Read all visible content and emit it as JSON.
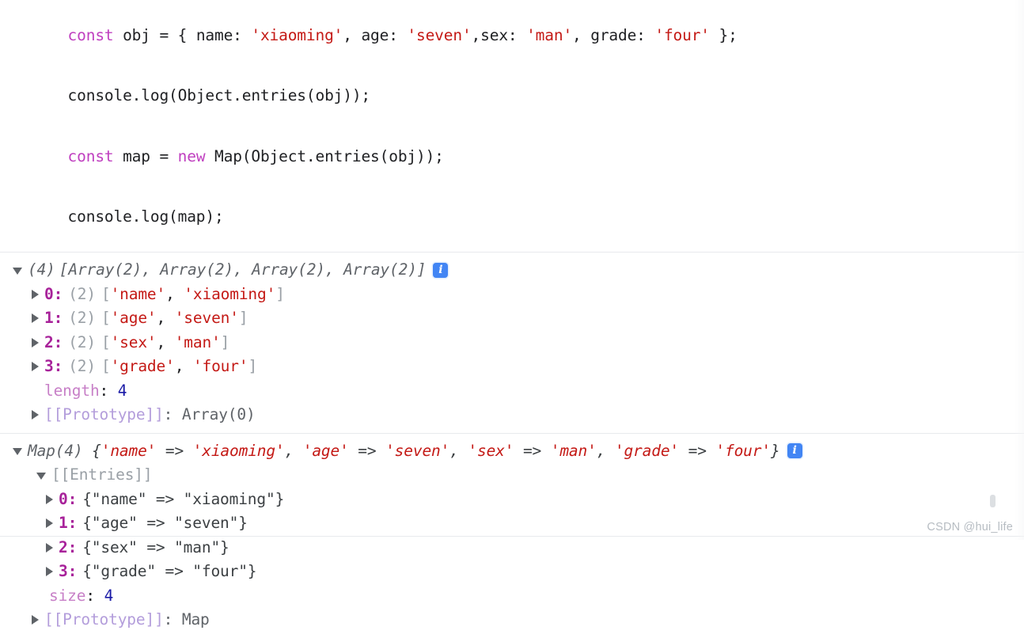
{
  "app": {
    "name": "browser-devtools-console",
    "watermark": "CSDN @hui_life"
  },
  "code_editor": {
    "lines": [
      {
        "id": "line-1",
        "tokens": [
          {
            "text": "const ",
            "style": "kw"
          },
          {
            "text": "obj = { name: ",
            "style": "plain"
          },
          {
            "text": "'xiaoming'",
            "style": "str"
          },
          {
            "text": ", age: ",
            "style": "plain"
          },
          {
            "text": "'seven'",
            "style": "str"
          },
          {
            "text": ",sex: ",
            "style": "plain"
          },
          {
            "text": "'man'",
            "style": "str"
          },
          {
            "text": ", grade: ",
            "style": "plain"
          },
          {
            "text": "'four'",
            "style": "str"
          },
          {
            "text": " };",
            "style": "plain"
          }
        ],
        "plain": "const obj = { name: 'xiaoming', age: 'seven',sex: 'man', grade: 'four' };"
      },
      {
        "id": "line-2",
        "tokens": [
          {
            "text": "console.log(Object.entries(obj));",
            "style": "plain"
          }
        ],
        "plain": "console.log(Object.entries(obj));"
      },
      {
        "id": "line-3",
        "tokens": [
          {
            "text": "const ",
            "style": "kw"
          },
          {
            "text": "map = ",
            "style": "plain"
          },
          {
            "text": "new ",
            "style": "kw"
          },
          {
            "text": "Map(Object.entries(obj));",
            "style": "plain"
          }
        ],
        "plain": "const map = new Map(Object.entries(obj));"
      },
      {
        "id": "line-4",
        "tokens": [
          {
            "text": "console.log(map);",
            "style": "plain"
          }
        ],
        "plain": "console.log(map);"
      }
    ]
  },
  "output_array": {
    "expanded": true,
    "header": {
      "count_label": "(4)",
      "preview": "[Array(2), Array(2), Array(2), Array(2)]",
      "info_badge": "i"
    },
    "rows": [
      {
        "index": "0:",
        "count": "(2)",
        "value": "['name', 'xiaoming']",
        "key_str": "'name'",
        "val_str": "'xiaoming'",
        "expanded": false
      },
      {
        "index": "1:",
        "count": "(2)",
        "value": "['age', 'seven']",
        "key_str": "'age'",
        "val_str": "'seven'",
        "expanded": false
      },
      {
        "index": "2:",
        "count": "(2)",
        "value": "['sex', 'man']",
        "key_str": "'sex'",
        "val_str": "'man'",
        "expanded": false
      },
      {
        "index": "3:",
        "count": "(2)",
        "value": "['grade', 'four']",
        "key_str": "'grade'",
        "val_str": "'four'",
        "expanded": false
      }
    ],
    "length_prop": {
      "name": "length",
      "separator": ": ",
      "value": "4"
    },
    "prototype": {
      "name": "[[Prototype]]",
      "separator": ": ",
      "value": "Array(0)"
    }
  },
  "output_map": {
    "expanded": true,
    "header": {
      "label": "Map(4) ",
      "preview_open": "{",
      "k1": "'name'",
      "a1": " => ",
      "v1": "'xiaoming'",
      "s1": ", ",
      "k2": "'age'",
      "a2": " => ",
      "v2": "'seven'",
      "s2": ", ",
      "k3": "'sex'",
      "a3": " => ",
      "v3": "'man'",
      "s3": ", ",
      "k4": "'grade'",
      "a4": " => ",
      "v4": "'four'",
      "preview_close": "}",
      "info_badge": "i"
    },
    "entries_label": "[[Entries]]",
    "entries_expanded": true,
    "entries": [
      {
        "index": "0:",
        "value": "{\"name\" => \"xiaoming\"}",
        "expanded": false
      },
      {
        "index": "1:",
        "value": "{\"age\" => \"seven\"}",
        "expanded": false
      },
      {
        "index": "2:",
        "value": "{\"sex\" => \"man\"}",
        "expanded": false
      },
      {
        "index": "3:",
        "value": "{\"grade\" => \"four\"}",
        "expanded": false
      }
    ],
    "size_prop": {
      "name": "size",
      "separator": ": ",
      "value": "4"
    },
    "prototype": {
      "name": "[[Prototype]]",
      "separator": ": ",
      "value": "Map"
    }
  },
  "colors": {
    "keyword": "#c040c0",
    "string": "#c41a16",
    "number": "#1a1aa6",
    "property": "#c77fc7",
    "index": "#a8229a",
    "muted": "#9aa0a6",
    "text": "#202124",
    "info_badge_bg": "#4285f4",
    "divider": "#e8eaed"
  }
}
